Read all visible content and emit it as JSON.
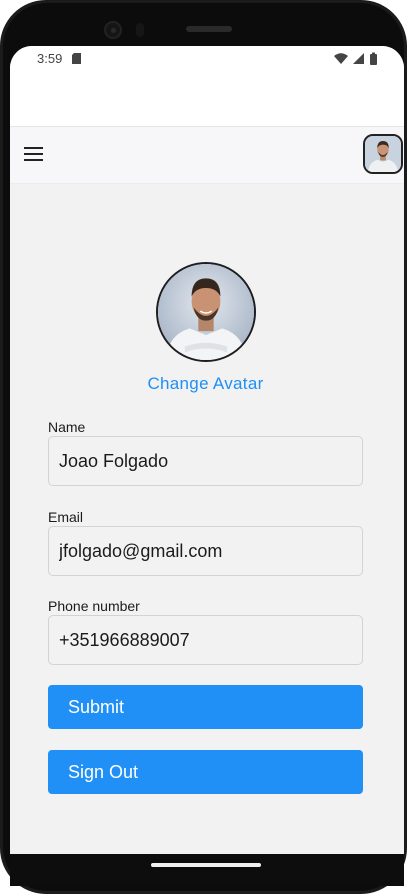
{
  "status_bar": {
    "time": "3:59"
  },
  "app_bar": {
    "menu_icon": "hamburger-menu-icon"
  },
  "profile": {
    "change_avatar_label": "Change Avatar"
  },
  "form": {
    "name": {
      "label": "Name",
      "value": "Joao Folgado"
    },
    "email": {
      "label": "Email",
      "value": "jfolgado@gmail.com"
    },
    "phone": {
      "label": "Phone number",
      "value": "+351966889007"
    }
  },
  "buttons": {
    "submit": "Submit",
    "sign_out": "Sign Out"
  },
  "colors": {
    "accent": "#2090f6",
    "link": "#1e8ff7",
    "background": "#f2f2f2"
  }
}
